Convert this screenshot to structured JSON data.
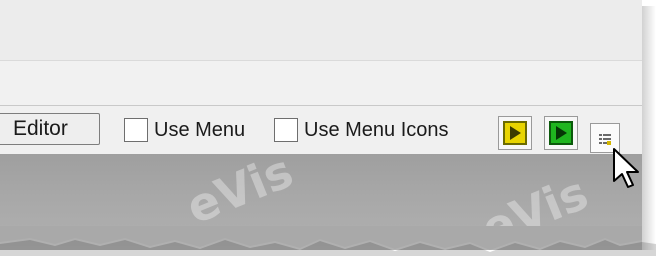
{
  "toolbar": {
    "editor_label": "Editor",
    "use_menu_label": "Use Menu",
    "use_menu_icons_label": "Use Menu Icons",
    "use_menu_checked": false,
    "use_menu_icons_checked": false
  },
  "watermark": {
    "text_1": "eVis",
    "text_2": "eVis"
  },
  "icons": {
    "yellow_button": "play-yellow-icon",
    "green_button": "play-green-icon",
    "small_button": "list-icon",
    "cursor": "mouse-cursor-icon"
  },
  "colors": {
    "yellow": "#e8d400",
    "green": "#1fb51f",
    "toolbar_bg": "#f0f0f0",
    "gray_area": "#a7a7a7"
  }
}
